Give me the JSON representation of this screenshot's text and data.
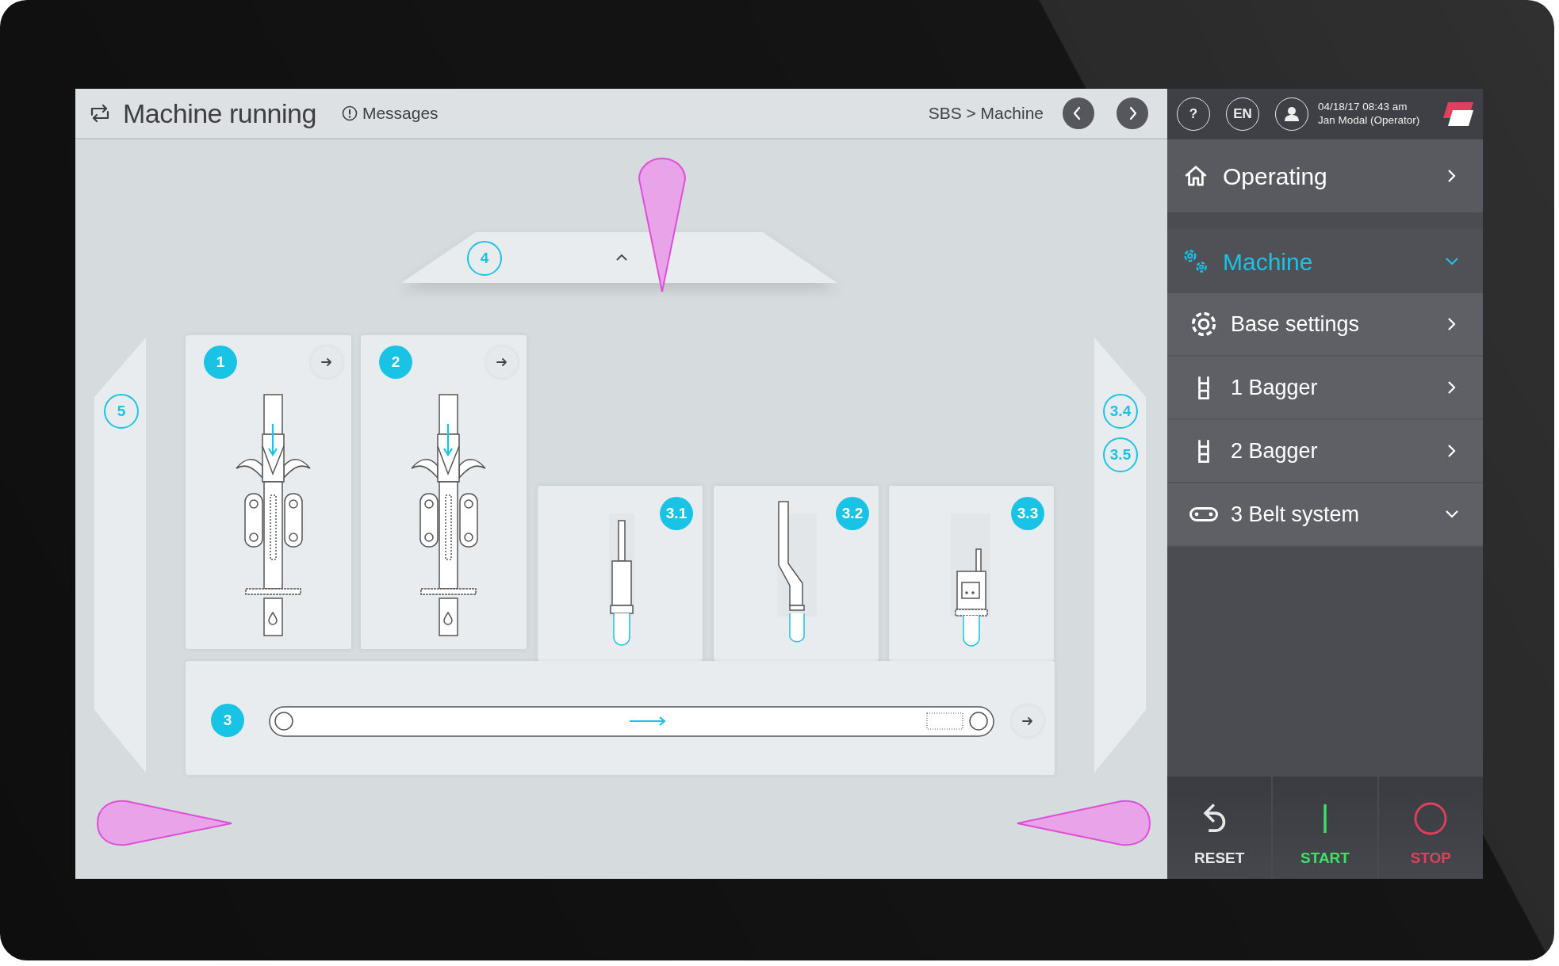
{
  "header": {
    "status_title": "Machine running",
    "messages_label": "Messages",
    "breadcrumb": "SBS > Machine"
  },
  "top_bar": {
    "help": "?",
    "language": "EN",
    "datetime": "04/18/17 08:43 am",
    "user": "Jan Modal (Operator)"
  },
  "menu": [
    {
      "label": "Operating",
      "kind": "home",
      "selected": false,
      "expanded": false
    },
    {
      "label": "Machine",
      "kind": "machine",
      "selected": true,
      "expanded": true,
      "children": [
        {
          "label": "Base settings",
          "kind": "settings",
          "expanded": false
        },
        {
          "label": "1 Bagger",
          "kind": "bagger",
          "expanded": false
        },
        {
          "label": "2 Bagger",
          "kind": "bagger",
          "expanded": false
        },
        {
          "label": "3 Belt system",
          "kind": "belt",
          "expanded": true
        }
      ]
    }
  ],
  "stations": [
    {
      "kind": "platform",
      "labels": [
        "4"
      ]
    },
    {
      "kind": "left-side",
      "labels": [
        "5"
      ]
    },
    {
      "kind": "right-side",
      "labels": [
        "3.4",
        "3.5"
      ]
    },
    {
      "kind": "bagger",
      "labels": [
        "1"
      ]
    },
    {
      "kind": "bagger",
      "labels": [
        "2"
      ]
    },
    {
      "kind": "nozzle",
      "labels": [
        "3.1"
      ]
    },
    {
      "kind": "bent-nozzle",
      "labels": [
        "3.2"
      ]
    },
    {
      "kind": "device",
      "labels": [
        "3.3"
      ]
    },
    {
      "kind": "belt",
      "labels": [
        "3"
      ]
    }
  ],
  "controls": [
    {
      "label": "RESET",
      "kind": "reset"
    },
    {
      "label": "START",
      "kind": "start"
    },
    {
      "label": "STOP",
      "kind": "stop"
    }
  ]
}
